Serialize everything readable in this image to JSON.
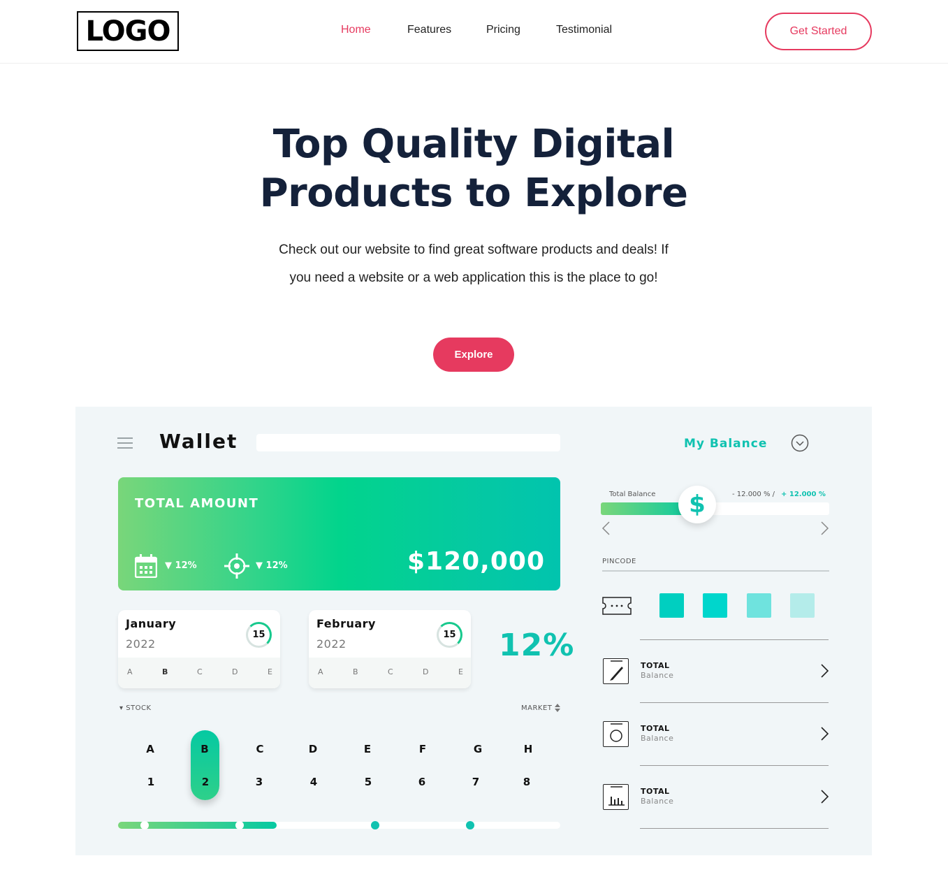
{
  "nav": {
    "logo": "LOGO",
    "items": [
      "Home",
      "Features",
      "Pricing",
      "Testimonial"
    ],
    "cta": "Get Started",
    "accent_color": "#e63a5f"
  },
  "hero": {
    "title_line1": "Top Quality Digital",
    "title_line2": "Products to Explore",
    "subtitle": "Check out our website to find great software products and deals! If you need a website or a web application this is the place to go!",
    "button": "Explore"
  },
  "dashboard": {
    "title": "Wallet",
    "my_balance": "My Balance",
    "total_card": {
      "label": "TOTAL AMOUNT",
      "amount": "$120,000",
      "stat1": "▼ 12%",
      "stat2": "▼ 12%"
    },
    "mini_cards": [
      {
        "month": "January",
        "year": "2022",
        "ring": "15",
        "letters": [
          "A",
          "B",
          "C",
          "D",
          "E"
        ]
      },
      {
        "month": "February",
        "year": "2022",
        "ring": "15",
        "letters": [
          "A",
          "B",
          "C",
          "D",
          "E"
        ]
      }
    ],
    "percent": "12%",
    "stock_label": "▾ STOCK",
    "market_label": "MARKET",
    "columns": {
      "letters": [
        "A",
        "B",
        "C",
        "D",
        "E",
        "F",
        "G",
        "H"
      ],
      "numbers": [
        "1",
        "2",
        "3",
        "4",
        "5",
        "6",
        "7",
        "8"
      ],
      "selected": "B"
    },
    "balance": {
      "label": "Total Balance",
      "range_neg": "- 12.000 % /",
      "range_pos": "+ 12.000 %",
      "symbol": "$"
    },
    "pincode_label": "PINCODE",
    "pin_colors": [
      "#00cfc0",
      "#00d6cc",
      "#6fe3de",
      "#b4ecea"
    ],
    "rows": [
      {
        "title": "TOTAL",
        "sub": "Balance",
        "icon": "pencil-icon"
      },
      {
        "title": "TOTAL",
        "sub": "Balance",
        "icon": "circle-icon"
      },
      {
        "title": "TOTAL",
        "sub": "Balance",
        "icon": "bar-chart-icon"
      }
    ]
  }
}
